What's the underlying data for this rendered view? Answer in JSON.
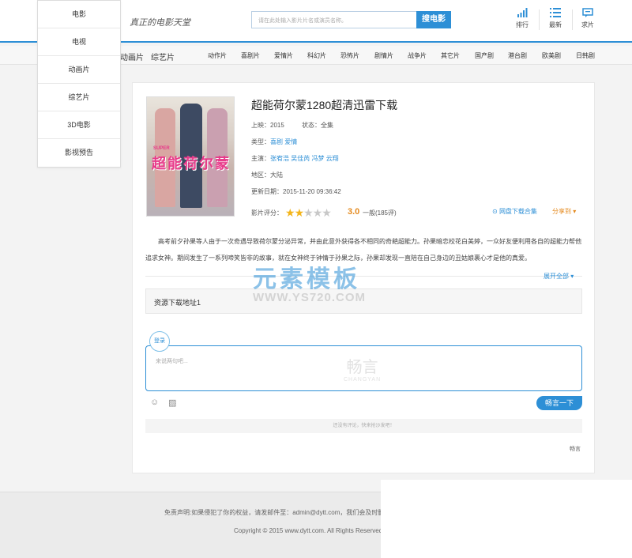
{
  "header": {
    "slogan": "真正的电影天堂",
    "search_placeholder": "请在此处输入影片片名或演员名称。",
    "search_button": "搜电影",
    "icons": [
      {
        "label": "排行",
        "icon": "bar-chart-icon",
        "glyph": "▁▃▅▇"
      },
      {
        "label": "最新",
        "icon": "list-icon",
        "glyph": "☰"
      },
      {
        "label": "求片",
        "icon": "chat-icon",
        "glyph": "▭"
      }
    ]
  },
  "nav": {
    "main": [
      "动画片",
      "综艺片"
    ],
    "genres": [
      "动作片",
      "喜剧片",
      "爱情片",
      "科幻片",
      "恐怖片",
      "剧情片",
      "战争片",
      "其它片",
      "国产剧",
      "港台剧",
      "欧美剧",
      "日韩剧"
    ]
  },
  "dropdown": [
    "电影",
    "电视",
    "动画片",
    "综艺片",
    "3D电影",
    "影视预告"
  ],
  "movie": {
    "title": "超能荷尔蒙1280超清迅雷下载",
    "poster_title": "超能荷尔蒙",
    "poster_sub": "SUPER",
    "release_label": "上映：",
    "release": "2015",
    "status_label": "状态：",
    "status": "全集",
    "type_label": "类型：",
    "types": "喜剧 爱情",
    "cast_label": "主演：",
    "cast": "张宥浩 吴佳芮 冯梦 云翔",
    "region_label": "地区：",
    "region": "大陆",
    "updated_label": "更新日期：",
    "updated": "2015-11-20 09:36:42",
    "rating_label": "影片评分：",
    "rating_stars": 2,
    "rating_max": 5,
    "score": "3.0",
    "level": "一般(185评)",
    "netdisk": "网盘下载合集",
    "share": "分享到",
    "description": "高考前夕孙果等人由于一次奇遇导致荷尔蒙分泌异常，并由此意外获得各不相同的奇葩超能力。孙果暗恋校花白美婷，一众好友便利用各自的超能力帮他追求女神。期间发生了一系列啼笑皆非的故事，就在女神终于钟情于孙果之际，孙果却发现一直陪在自己身边的丑姑娘裹心才是他的真爱。",
    "expand": "展开全部",
    "download_title": "资源下载地址1"
  },
  "watermark": {
    "cn": "元素模板",
    "en": "WWW.YS720.COM"
  },
  "comments": {
    "login": "登录",
    "placeholder": "来说两句吧...",
    "brand_cn": "畅言",
    "brand_en": "CHANGYAN",
    "submit": "畅言一下",
    "empty": "还没有评论，快来抢沙发吧！",
    "footer_brand": "畅言"
  },
  "footer": {
    "notice": "免责声明:如果侵犯了你的权益，请发邮件至：admin@dytt.com，我们会及时删除侵权内容，谢谢合作！",
    "copyright": "Copyright © 2015 www.dytt.com. All Rights Reserved"
  }
}
